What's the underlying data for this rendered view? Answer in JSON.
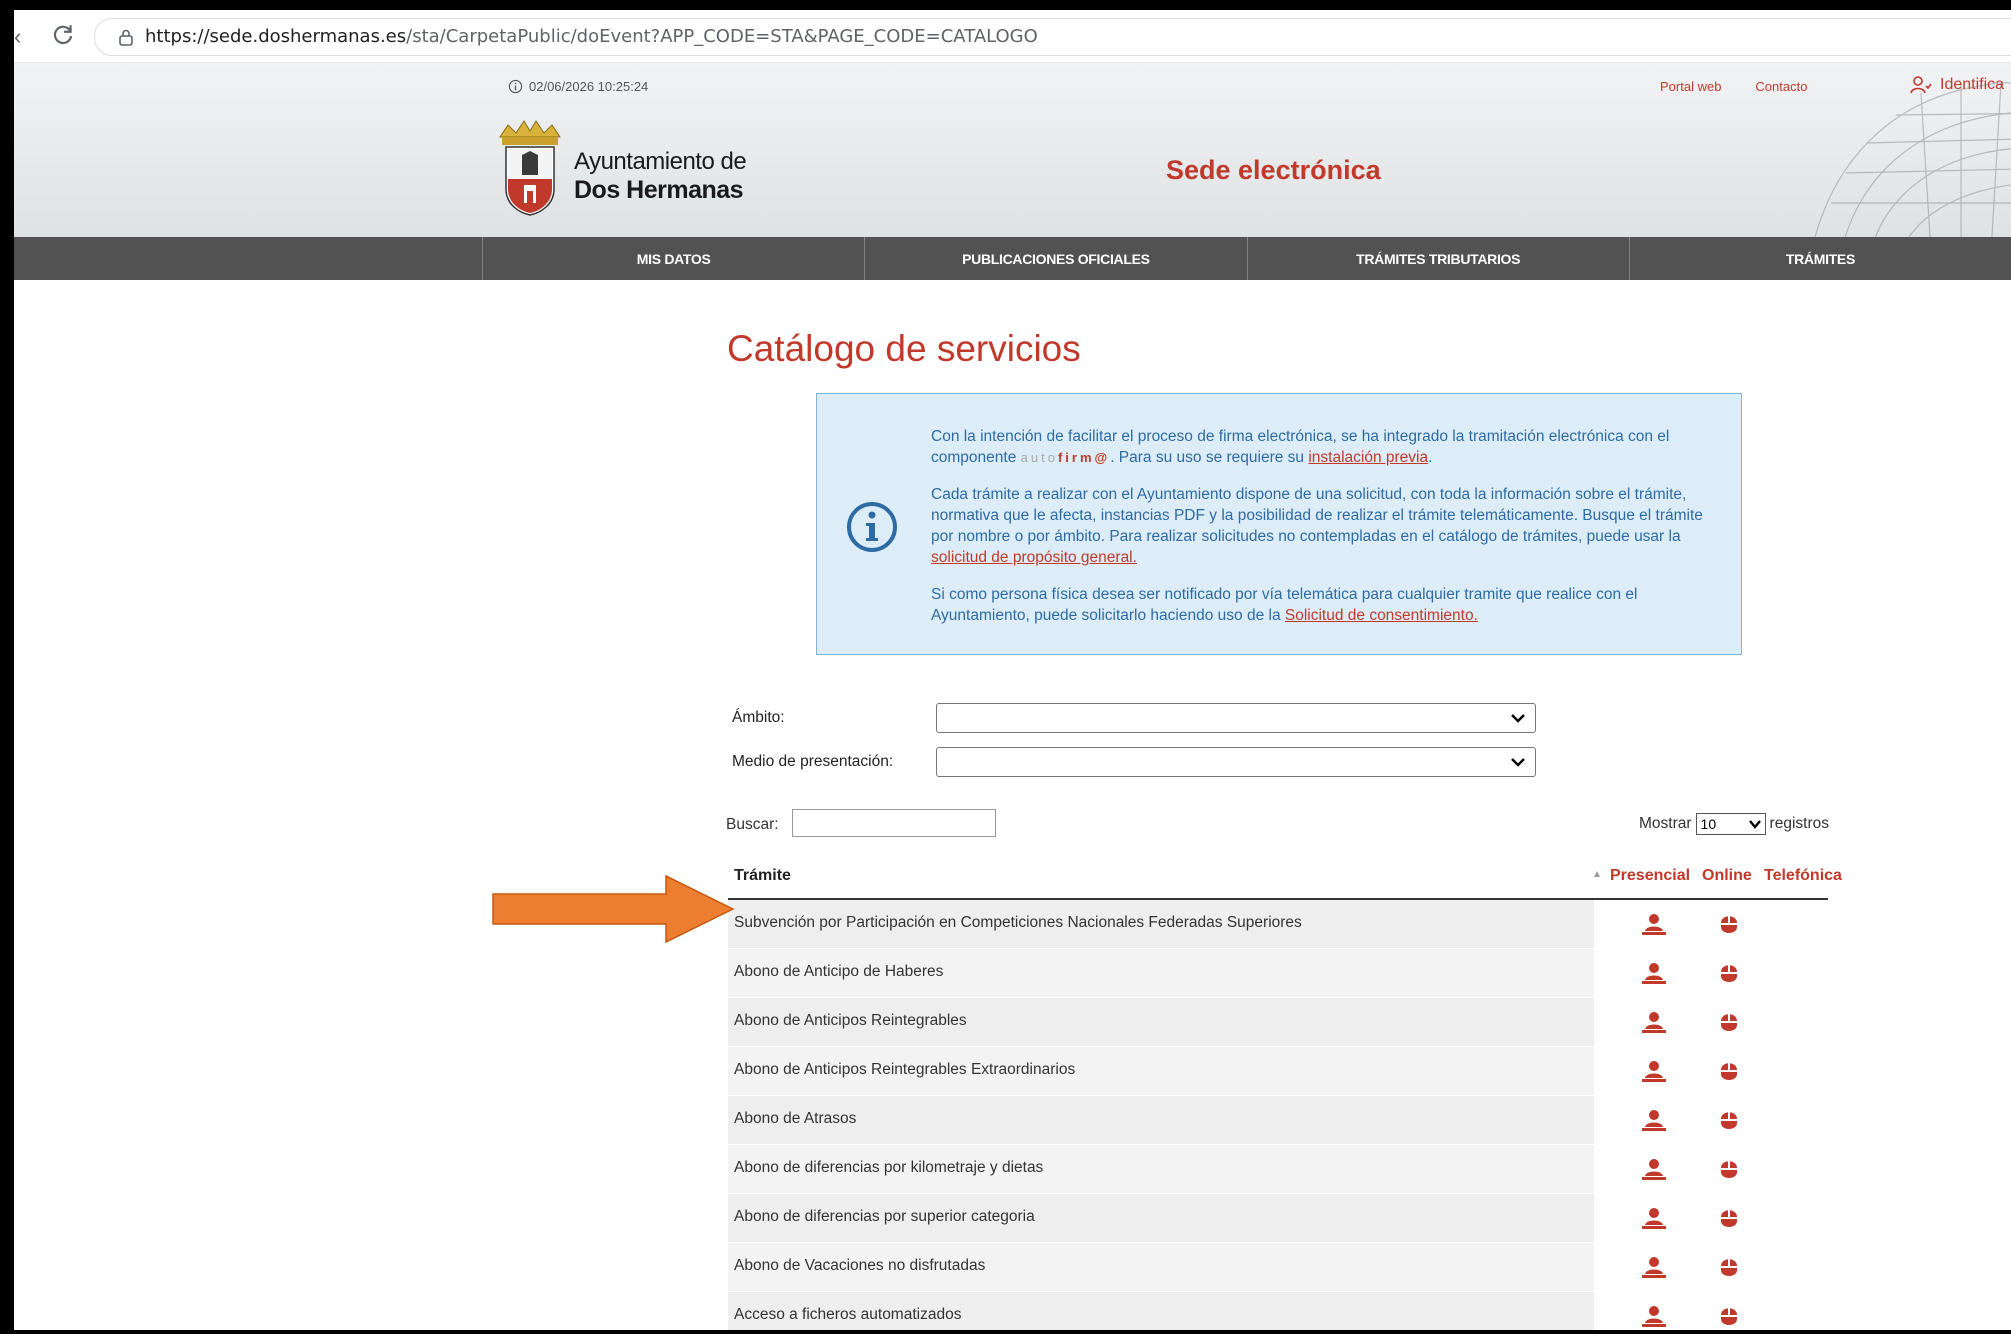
{
  "browser": {
    "url_domain": "https://sede.doshermanas.es",
    "url_path": "/sta/CarpetaPublic/doEvent?APP_CODE=STA&PAGE_CODE=CATALOGO"
  },
  "header": {
    "timestamp": "02/06/2026 10:25:24",
    "links": [
      "Portal web",
      "Contacto"
    ],
    "login_label": "Identifica",
    "org_line1": "Ayuntamiento de",
    "org_line2": "Dos Hermanas",
    "site_title": "Sede electrónica"
  },
  "nav": {
    "items": [
      "MIS DATOS",
      "PUBLICACIONES OFICIALES",
      "TRÁMITES TRIBUTARIOS",
      "TRÁMITES"
    ]
  },
  "page": {
    "title": "Catálogo de servicios"
  },
  "info": {
    "p1_text1": "Con la intención de facilitar el proceso de firma electrónica, se ha integrado la tramitación electrónica con el componente ",
    "p1_brand_a": "auto",
    "p1_brand_b": "firm@",
    "p1_text2": ". Para su uso se requiere su ",
    "p1_link": "instalación previa",
    "p1_text3": ".",
    "p2_text": "Cada trámite a realizar con el Ayuntamiento dispone de una solicitud, con toda la información sobre el trámite, normativa que le afecta, instancias PDF y la posibilidad de realizar el trámite telemáticamente. Busque el trámite por nombre o por ámbito. Para realizar solicitudes no contempladas en el catálogo de trámites, puede usar la ",
    "p2_link": "solicitud de propósito general.",
    "p3_text": "Si como persona física desea ser notificado por vía telemática para cualquier tramite que realice con el Ayuntamiento, puede solicitarlo haciendo uso de la ",
    "p3_link": "Solicitud de consentimiento."
  },
  "filters": {
    "ambito_label": "Ámbito:",
    "ambito_value": "",
    "medio_label": "Medio de presentación:",
    "medio_value": ""
  },
  "search": {
    "label": "Buscar:",
    "value": ""
  },
  "pagination": {
    "show_label": "Mostrar",
    "show_value": "10",
    "records_label": "registros"
  },
  "table": {
    "headers": {
      "tramite": "Trámite",
      "presencial": "Presencial",
      "online": "Online",
      "telefonica": "Telefónica"
    },
    "rows": [
      {
        "name": "Subvención por Participación en Competiciones Nacionales Federadas Superiores"
      },
      {
        "name": "Abono de Anticipo de Haberes"
      },
      {
        "name": "Abono de Anticipos Reintegrables"
      },
      {
        "name": "Abono de Anticipos Reintegrables Extraordinarios"
      },
      {
        "name": "Abono de Atrasos"
      },
      {
        "name": "Abono de diferencias por kilometraje y dietas"
      },
      {
        "name": "Abono de diferencias por superior categoria"
      },
      {
        "name": "Abono de Vacaciones no disfrutadas"
      },
      {
        "name": "Acceso a ficheros automatizados"
      }
    ]
  },
  "icons": {
    "presencial": "person-icon",
    "online": "mouse-icon",
    "info": "info-icon",
    "highlight": "arrow-icon"
  },
  "colors": {
    "brand_red": "#c0392b",
    "nav_bg": "#525252",
    "info_bg": "#dcedf8",
    "info_text": "#2e6aa3",
    "highlight_arrow": "#ed7d31"
  }
}
